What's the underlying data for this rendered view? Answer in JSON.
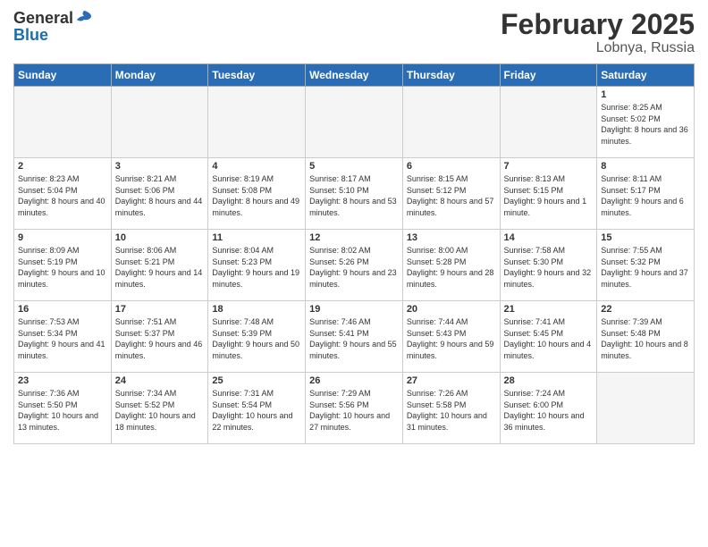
{
  "header": {
    "logo_general": "General",
    "logo_blue": "Blue",
    "month_title": "February 2025",
    "location": "Lobnya, Russia"
  },
  "weekdays": [
    "Sunday",
    "Monday",
    "Tuesday",
    "Wednesday",
    "Thursday",
    "Friday",
    "Saturday"
  ],
  "weeks": [
    [
      {
        "day": "",
        "info": ""
      },
      {
        "day": "",
        "info": ""
      },
      {
        "day": "",
        "info": ""
      },
      {
        "day": "",
        "info": ""
      },
      {
        "day": "",
        "info": ""
      },
      {
        "day": "",
        "info": ""
      },
      {
        "day": "1",
        "info": "Sunrise: 8:25 AM\nSunset: 5:02 PM\nDaylight: 8 hours and 36 minutes."
      }
    ],
    [
      {
        "day": "2",
        "info": "Sunrise: 8:23 AM\nSunset: 5:04 PM\nDaylight: 8 hours and 40 minutes."
      },
      {
        "day": "3",
        "info": "Sunrise: 8:21 AM\nSunset: 5:06 PM\nDaylight: 8 hours and 44 minutes."
      },
      {
        "day": "4",
        "info": "Sunrise: 8:19 AM\nSunset: 5:08 PM\nDaylight: 8 hours and 49 minutes."
      },
      {
        "day": "5",
        "info": "Sunrise: 8:17 AM\nSunset: 5:10 PM\nDaylight: 8 hours and 53 minutes."
      },
      {
        "day": "6",
        "info": "Sunrise: 8:15 AM\nSunset: 5:12 PM\nDaylight: 8 hours and 57 minutes."
      },
      {
        "day": "7",
        "info": "Sunrise: 8:13 AM\nSunset: 5:15 PM\nDaylight: 9 hours and 1 minute."
      },
      {
        "day": "8",
        "info": "Sunrise: 8:11 AM\nSunset: 5:17 PM\nDaylight: 9 hours and 6 minutes."
      }
    ],
    [
      {
        "day": "9",
        "info": "Sunrise: 8:09 AM\nSunset: 5:19 PM\nDaylight: 9 hours and 10 minutes."
      },
      {
        "day": "10",
        "info": "Sunrise: 8:06 AM\nSunset: 5:21 PM\nDaylight: 9 hours and 14 minutes."
      },
      {
        "day": "11",
        "info": "Sunrise: 8:04 AM\nSunset: 5:23 PM\nDaylight: 9 hours and 19 minutes."
      },
      {
        "day": "12",
        "info": "Sunrise: 8:02 AM\nSunset: 5:26 PM\nDaylight: 9 hours and 23 minutes."
      },
      {
        "day": "13",
        "info": "Sunrise: 8:00 AM\nSunset: 5:28 PM\nDaylight: 9 hours and 28 minutes."
      },
      {
        "day": "14",
        "info": "Sunrise: 7:58 AM\nSunset: 5:30 PM\nDaylight: 9 hours and 32 minutes."
      },
      {
        "day": "15",
        "info": "Sunrise: 7:55 AM\nSunset: 5:32 PM\nDaylight: 9 hours and 37 minutes."
      }
    ],
    [
      {
        "day": "16",
        "info": "Sunrise: 7:53 AM\nSunset: 5:34 PM\nDaylight: 9 hours and 41 minutes."
      },
      {
        "day": "17",
        "info": "Sunrise: 7:51 AM\nSunset: 5:37 PM\nDaylight: 9 hours and 46 minutes."
      },
      {
        "day": "18",
        "info": "Sunrise: 7:48 AM\nSunset: 5:39 PM\nDaylight: 9 hours and 50 minutes."
      },
      {
        "day": "19",
        "info": "Sunrise: 7:46 AM\nSunset: 5:41 PM\nDaylight: 9 hours and 55 minutes."
      },
      {
        "day": "20",
        "info": "Sunrise: 7:44 AM\nSunset: 5:43 PM\nDaylight: 9 hours and 59 minutes."
      },
      {
        "day": "21",
        "info": "Sunrise: 7:41 AM\nSunset: 5:45 PM\nDaylight: 10 hours and 4 minutes."
      },
      {
        "day": "22",
        "info": "Sunrise: 7:39 AM\nSunset: 5:48 PM\nDaylight: 10 hours and 8 minutes."
      }
    ],
    [
      {
        "day": "23",
        "info": "Sunrise: 7:36 AM\nSunset: 5:50 PM\nDaylight: 10 hours and 13 minutes."
      },
      {
        "day": "24",
        "info": "Sunrise: 7:34 AM\nSunset: 5:52 PM\nDaylight: 10 hours and 18 minutes."
      },
      {
        "day": "25",
        "info": "Sunrise: 7:31 AM\nSunset: 5:54 PM\nDaylight: 10 hours and 22 minutes."
      },
      {
        "day": "26",
        "info": "Sunrise: 7:29 AM\nSunset: 5:56 PM\nDaylight: 10 hours and 27 minutes."
      },
      {
        "day": "27",
        "info": "Sunrise: 7:26 AM\nSunset: 5:58 PM\nDaylight: 10 hours and 31 minutes."
      },
      {
        "day": "28",
        "info": "Sunrise: 7:24 AM\nSunset: 6:00 PM\nDaylight: 10 hours and 36 minutes."
      },
      {
        "day": "",
        "info": ""
      }
    ]
  ]
}
